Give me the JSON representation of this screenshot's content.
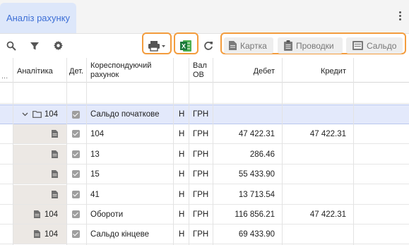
{
  "tab": {
    "title": "Аналіз рахунку"
  },
  "toolbar": {
    "btn_card": "Картка",
    "btn_postings": "Проводки",
    "btn_balance": "Сальдо"
  },
  "columns": {
    "ellipsis": "...",
    "analytics": "Аналітика",
    "det": "Дет.",
    "corr1": "Кореспондуючий",
    "corr2": "рахунок",
    "cur1": "Вал",
    "cur2": "ОВ",
    "debit": "Дебет",
    "credit": "Кредит"
  },
  "rows": [
    {
      "analytics": "104",
      "kind": "group",
      "det": true,
      "account": "Сальдо початкове",
      "flag": "Н",
      "currency": "ГРН",
      "debit": "",
      "credit": ""
    },
    {
      "analytics": "",
      "kind": "doc",
      "det": true,
      "account": "104",
      "flag": "Н",
      "currency": "ГРН",
      "debit": "47 422.31",
      "credit": "47 422.31"
    },
    {
      "analytics": "",
      "kind": "doc",
      "det": true,
      "account": "13",
      "flag": "Н",
      "currency": "ГРН",
      "debit": "286.46",
      "credit": ""
    },
    {
      "analytics": "",
      "kind": "doc",
      "det": true,
      "account": "15",
      "flag": "Н",
      "currency": "ГРН",
      "debit": "55 433.90",
      "credit": ""
    },
    {
      "analytics": "",
      "kind": "doc",
      "det": true,
      "account": "41",
      "flag": "Н",
      "currency": "ГРН",
      "debit": "13 713.54",
      "credit": ""
    },
    {
      "analytics": "104",
      "kind": "doc",
      "det": true,
      "account": "Обороти",
      "flag": "Н",
      "currency": "ГРН",
      "debit": "116 856.21",
      "credit": "47 422.31"
    },
    {
      "analytics": "104",
      "kind": "doc",
      "det": true,
      "account": "Сальдо кінцеве",
      "flag": "Н",
      "currency": "ГРН",
      "debit": "69 433.90",
      "credit": ""
    }
  ]
}
